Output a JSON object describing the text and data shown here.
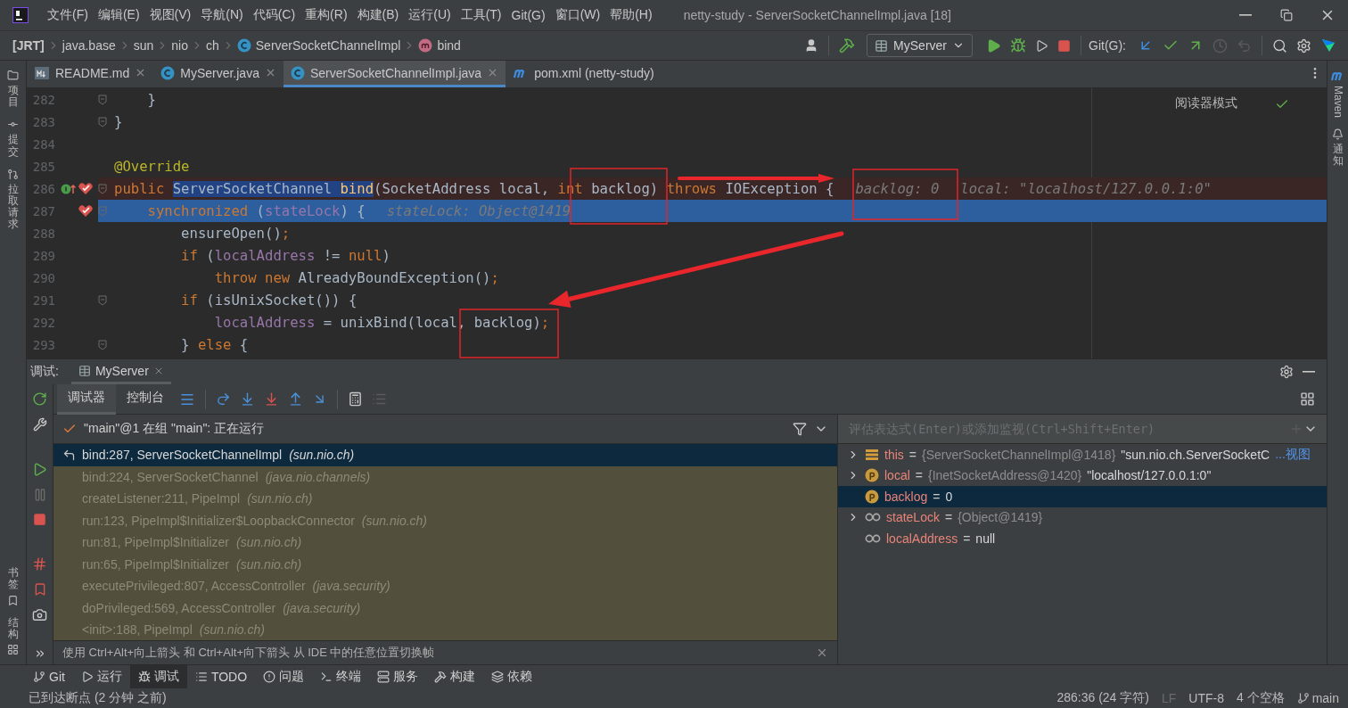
{
  "window": {
    "title": "netty-study - ServerSocketChannelImpl.java [18]"
  },
  "menu": [
    "文件(F)",
    "编辑(E)",
    "视图(V)",
    "导航(N)",
    "代码(C)",
    "重构(R)",
    "构建(B)",
    "运行(U)",
    "工具(T)",
    "Git(G)",
    "窗口(W)",
    "帮助(H)"
  ],
  "breadcrumbs": [
    {
      "label": "[JRT]",
      "kind": "module"
    },
    {
      "label": "java.base",
      "kind": "plain"
    },
    {
      "label": "sun",
      "kind": "plain"
    },
    {
      "label": "nio",
      "kind": "plain"
    },
    {
      "label": "ch",
      "kind": "plain"
    },
    {
      "label": "ServerSocketChannelImpl",
      "kind": "class"
    },
    {
      "label": "bind",
      "kind": "method"
    }
  ],
  "toolbar": {
    "run_config": "MyServer",
    "git_label": "Git(G):"
  },
  "editor_tabs": [
    {
      "label": "README.md",
      "kind": "markdown",
      "selected": false,
      "closable": true
    },
    {
      "label": "MyServer.java",
      "kind": "java-run",
      "selected": false,
      "closable": true
    },
    {
      "label": "ServerSocketChannelImpl.java",
      "kind": "java",
      "selected": true,
      "closable": true
    },
    {
      "label": "pom.xml (netty-study)",
      "kind": "maven",
      "selected": false,
      "closable": false
    }
  ],
  "left_strip": {
    "top": [
      "项目",
      "提交",
      "拉取请求"
    ],
    "bottom": [
      "书签",
      "结构"
    ]
  },
  "right_strip": [
    "Maven",
    "通知"
  ],
  "editor": {
    "reader_mode": "阅读器模式",
    "lines": [
      {
        "number": "282",
        "kind": "normal",
        "fold": true,
        "breakpoint": false,
        "override": false,
        "code": [
          {
            "text": "    }",
            "kind": "plain"
          }
        ]
      },
      {
        "number": "283",
        "kind": "normal",
        "fold": true,
        "breakpoint": false,
        "override": false,
        "code": [
          {
            "text": "}",
            "kind": "plain"
          }
        ]
      },
      {
        "number": "284",
        "kind": "normal",
        "fold": false,
        "breakpoint": false,
        "override": false
      },
      {
        "number": "285",
        "kind": "normal",
        "fold": false,
        "breakpoint": false,
        "override": false,
        "code": [
          {
            "text": "@Override",
            "kind": "annotation"
          }
        ]
      },
      {
        "number": "286",
        "kind": "breakpoint",
        "fold": true,
        "breakpoint": true,
        "override": true,
        "code": [
          {
            "text": "public ",
            "kind": "keyword"
          },
          {
            "text": "ServerSocketChannel ",
            "kind": "selection"
          },
          {
            "text": "bind",
            "kind": "selection-method"
          },
          {
            "text": "(SocketAddress local, ",
            "kind": "plain"
          },
          {
            "text": "int",
            "kind": "keyword"
          },
          {
            "text": " backlog) ",
            "kind": "plain"
          },
          {
            "text": "throws",
            "kind": "keyword"
          },
          {
            "text": " IOException {",
            "kind": "plain"
          }
        ],
        "hints": [
          "backlog: 0",
          "local: \"localhost/127.0.0.1:0\""
        ]
      },
      {
        "number": "287",
        "kind": "current",
        "fold": true,
        "breakpoint": true,
        "override": false,
        "code": [
          {
            "text": "    synchronized",
            "kind": "keyword"
          },
          {
            "text": " (",
            "kind": "plain"
          },
          {
            "text": "stateLock",
            "kind": "field"
          },
          {
            "text": ") {",
            "kind": "plain"
          }
        ],
        "hints": [
          "stateLock: Object@1419"
        ]
      },
      {
        "number": "288",
        "kind": "normal",
        "fold": false,
        "breakpoint": false,
        "override": false,
        "code": [
          {
            "text": "        ensureOpen()",
            "kind": "plain"
          },
          {
            "text": ";",
            "kind": "keyword"
          }
        ]
      },
      {
        "number": "289",
        "kind": "normal",
        "fold": false,
        "breakpoint": false,
        "override": false,
        "code": [
          {
            "text": "        if",
            "kind": "keyword"
          },
          {
            "text": " (",
            "kind": "plain"
          },
          {
            "text": "localAddress",
            "kind": "field"
          },
          {
            "text": " != ",
            "kind": "plain"
          },
          {
            "text": "null",
            "kind": "keyword"
          },
          {
            "text": ")",
            "kind": "plain"
          }
        ]
      },
      {
        "number": "290",
        "kind": "normal",
        "fold": false,
        "breakpoint": false,
        "override": false,
        "code": [
          {
            "text": "            throw new",
            "kind": "keyword"
          },
          {
            "text": " AlreadyBoundException()",
            "kind": "plain"
          },
          {
            "text": ";",
            "kind": "keyword"
          }
        ]
      },
      {
        "number": "291",
        "kind": "normal",
        "fold": true,
        "breakpoint": false,
        "override": false,
        "code": [
          {
            "text": "        if",
            "kind": "keyword"
          },
          {
            "text": " (isUnixSocket()) {",
            "kind": "plain"
          }
        ]
      },
      {
        "number": "292",
        "kind": "normal",
        "fold": false,
        "breakpoint": false,
        "override": false,
        "code": [
          {
            "text": "            localAddress",
            "kind": "field"
          },
          {
            "text": " = unixBind(local, backlog)",
            "kind": "plain"
          },
          {
            "text": ";",
            "kind": "keyword"
          }
        ]
      },
      {
        "number": "293",
        "kind": "normal",
        "fold": true,
        "breakpoint": false,
        "override": false,
        "code": [
          {
            "text": "        } ",
            "kind": "plain"
          },
          {
            "text": "else",
            "kind": "keyword"
          },
          {
            "text": " {",
            "kind": "plain"
          }
        ]
      }
    ]
  },
  "debug": {
    "label": "调试:",
    "session_tab": "MyServer",
    "tabs": [
      {
        "label": "调试器",
        "selected": true
      },
      {
        "label": "控制台",
        "selected": false
      }
    ],
    "thread": "\"main\"@1 在组 \"main\": 正在运行",
    "frames": [
      {
        "method": "bind:287, ServerSocketChannelImpl",
        "package": "(sun.nio.ch)",
        "selected": true
      },
      {
        "method": "bind:224, ServerSocketChannel",
        "package": "(java.nio.channels)",
        "selected": false
      },
      {
        "method": "createListener:211, PipeImpl",
        "package": "(sun.nio.ch)",
        "selected": false
      },
      {
        "method": "run:123, PipeImpl$Initializer$LoopbackConnector",
        "package": "(sun.nio.ch)",
        "selected": false
      },
      {
        "method": "run:81, PipeImpl$Initializer",
        "package": "(sun.nio.ch)",
        "selected": false
      },
      {
        "method": "run:65, PipeImpl$Initializer",
        "package": "(sun.nio.ch)",
        "selected": false
      },
      {
        "method": "executePrivileged:807, AccessController",
        "package": "(java.security)",
        "selected": false
      },
      {
        "method": "doPrivileged:569, AccessController",
        "package": "(java.security)",
        "selected": false
      },
      {
        "method": "<init>:188, PipeImpl",
        "package": "(sun.nio.ch)",
        "selected": false
      }
    ],
    "hint": "使用 Ctrl+Alt+向上箭头 和 Ctrl+Alt+向下箭头 从 IDE 中的任意位置切换帧",
    "evaluate_placeholder": "评估表达式(Enter)或添加监视(Ctrl+Shift+Enter)",
    "variables": [
      {
        "name": "this",
        "operator": "=",
        "kind": "object",
        "expandable": true,
        "selected": false,
        "type": "{ServerSocketChannelImpl@1418}",
        "value": "\"sun.nio.ch.ServerSocketC",
        "link": "...视图"
      },
      {
        "name": "local",
        "operator": "=",
        "kind": "parameter",
        "expandable": true,
        "selected": false,
        "type": "{InetSocketAddress@1420}",
        "value": "\"localhost/127.0.0.1:0\""
      },
      {
        "name": "backlog",
        "operator": "=",
        "kind": "parameter",
        "expandable": false,
        "selected": true,
        "value": "0"
      },
      {
        "name": "stateLock",
        "operator": "=",
        "kind": "watch",
        "expandable": true,
        "selected": false,
        "type": "{Object@1419}"
      },
      {
        "name": "localAddress",
        "operator": "=",
        "kind": "watch",
        "expandable": false,
        "selected": false,
        "value": "null"
      }
    ]
  },
  "tool_tabs": [
    {
      "label": "Git",
      "kind": "git",
      "selected": false
    },
    {
      "label": "运行",
      "kind": "run",
      "selected": false
    },
    {
      "label": "调试",
      "kind": "debug",
      "selected": true
    },
    {
      "label": "TODO",
      "kind": "todo",
      "selected": false
    },
    {
      "label": "问题",
      "kind": "problems",
      "selected": false
    },
    {
      "label": "终端",
      "kind": "terminal",
      "selected": false
    },
    {
      "label": "服务",
      "kind": "services",
      "selected": false
    },
    {
      "label": "构建",
      "kind": "build",
      "selected": false
    },
    {
      "label": "依赖",
      "kind": "deps",
      "selected": false
    }
  ],
  "status": {
    "message": "已到达断点 (2 分钟 之前)",
    "items": [
      {
        "label": "286:36 (24 字符)",
        "kind": "text",
        "disabled": false
      },
      {
        "label": "LF",
        "kind": "text",
        "disabled": true
      },
      {
        "label": "UTF-8",
        "kind": "text",
        "disabled": false
      },
      {
        "label": "4 个空格",
        "kind": "text",
        "disabled": false
      },
      {
        "label": "main",
        "kind": "branch",
        "disabled": false
      }
    ]
  }
}
